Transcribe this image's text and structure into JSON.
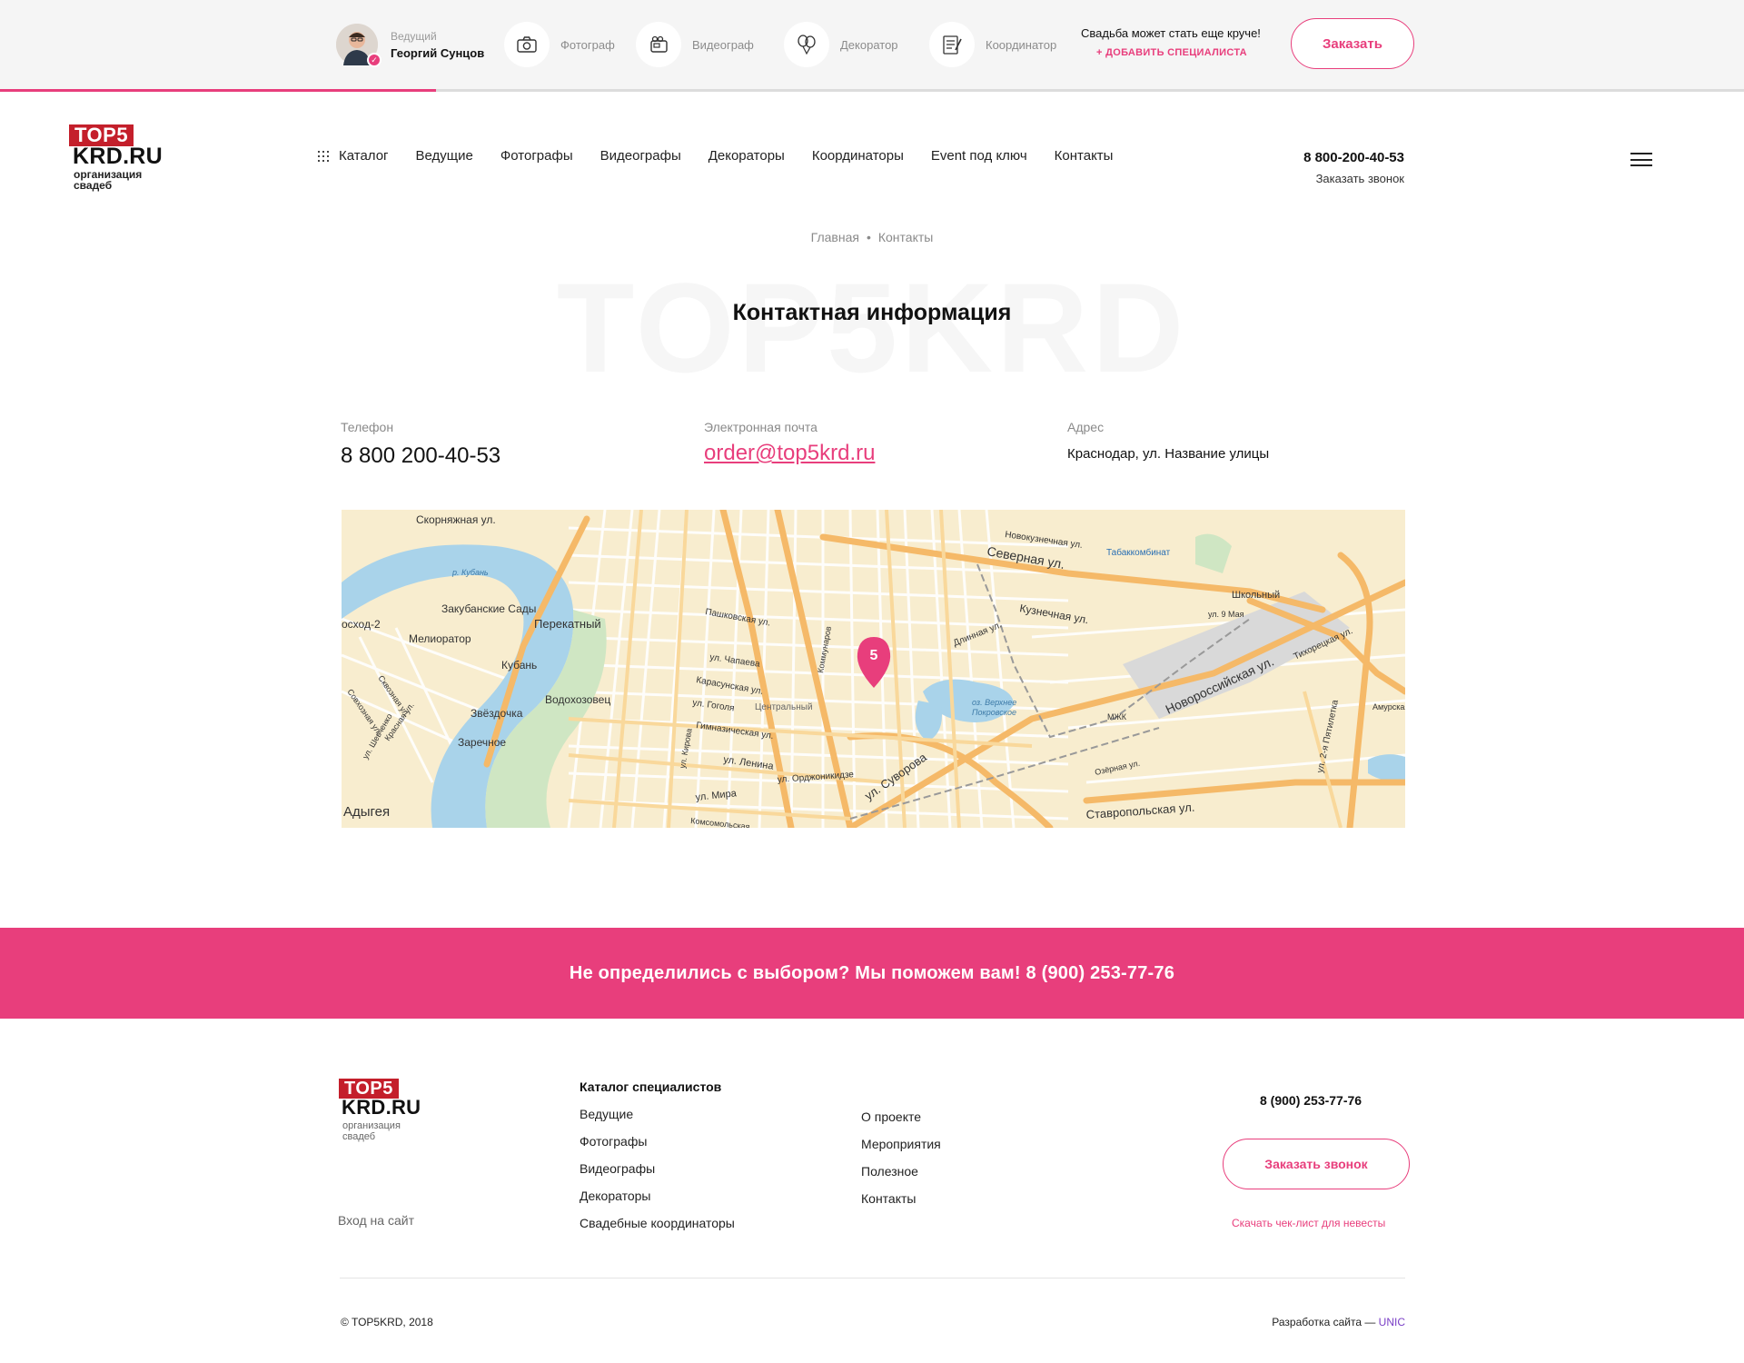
{
  "topbar": {
    "host": {
      "role": "Ведущий",
      "name": "Георгий Сунцов",
      "check": "✓"
    },
    "specialists": [
      {
        "label": "Фотограф",
        "icon": "camera-icon"
      },
      {
        "label": "Видеограф",
        "icon": "video-camera-icon"
      },
      {
        "label": "Декоратор",
        "icon": "balloons-icon"
      },
      {
        "label": "Координатор",
        "icon": "notepad-icon"
      }
    ],
    "promo_text": "Свадьба может стать еще круче!",
    "promo_link": "+ ДОБАВИТЬ СПЕЦИАЛИСТА",
    "order_button": "Заказать",
    "progress": 0.25,
    "accent_color": "#e83e7c"
  },
  "logo": {
    "top": "TOP5",
    "main": "KRD.RU",
    "sub1": "организация",
    "sub2": "свадеб"
  },
  "nav": {
    "catalog": "Каталог",
    "items": [
      "Ведущие",
      "Фотографы",
      "Видеографы",
      "Декораторы",
      "Координаторы",
      "Event под ключ",
      "Контакты"
    ]
  },
  "header": {
    "phone": "8 800-200-40-53",
    "callback": "Заказать звонок"
  },
  "breadcrumb": {
    "home": "Главная",
    "sep": "•",
    "current": "Контакты"
  },
  "page": {
    "watermark": "TOP5KRD",
    "title": "Контактная информация"
  },
  "contacts": {
    "phone_label": "Телефон",
    "phone": "8 800 200-40-53",
    "email_label": "Электронная почта",
    "email": "order@top5krd.ru",
    "address_label": "Адрес",
    "address": "Краснодар, ул. Название улицы"
  },
  "map": {
    "marker": "5",
    "labels": [
      "Скорняжная ул.",
      "р. Кубань",
      "Закубанские Сады",
      "Перекатный",
      "осход-2",
      "Мелиоратор",
      "Кубань",
      "Водохозовец",
      "Звёздочка",
      "Заречное",
      "Адыгея",
      "Северная ул.",
      "Кузнечная ул.",
      "Новокузнечная ул.",
      "Табаккомбинат",
      "Школьный",
      "ул. 9 Мая",
      "Новороссийская ул.",
      "Тихорецкая ул.",
      "Ставропольская ул.",
      "ул. Суворова",
      "Центральный",
      "ул. Ленина",
      "ул. Мира",
      "ул. Орджоникидзе",
      "Гимназическая ул.",
      "Карасунская ул.",
      "ул. Гоголя",
      "ул. Чапаева",
      "Пашковская ул.",
      "Длинная ул.",
      "оз. Верхнее",
      "Покровское",
      "МЖК",
      "Озёрная ул.",
      "ул. 2-я Пятилетка",
      "Амурская",
      "Коммунаров",
      "Красная ул.",
      "Сквозная ул.",
      "Совхозная ул.",
      "ул. Шевченко",
      "ул. Кирова",
      "Комсомольская"
    ]
  },
  "cta": {
    "text": "Не определились с выбором? Мы поможем вам! 8 (900) 253-77-76"
  },
  "footer": {
    "catalog_title": "Каталог специалистов",
    "catalog_links": [
      "Ведущие",
      "Фотографы",
      "Видеографы",
      "Декораторы",
      "Свадебные координаторы"
    ],
    "about_links": [
      "О проекте",
      "Мероприятия",
      "Полезное",
      "Контакты"
    ],
    "login": "Вход на сайт",
    "phone": "8 (900) 253-77-76",
    "call_button": "Заказать звонок",
    "checklist": "Скачать чек-лист для невесты",
    "copyright": "© TOP5KRD, 2018",
    "dev_prefix": "Разработка сайта — ",
    "dev_brand": "UNIC"
  }
}
